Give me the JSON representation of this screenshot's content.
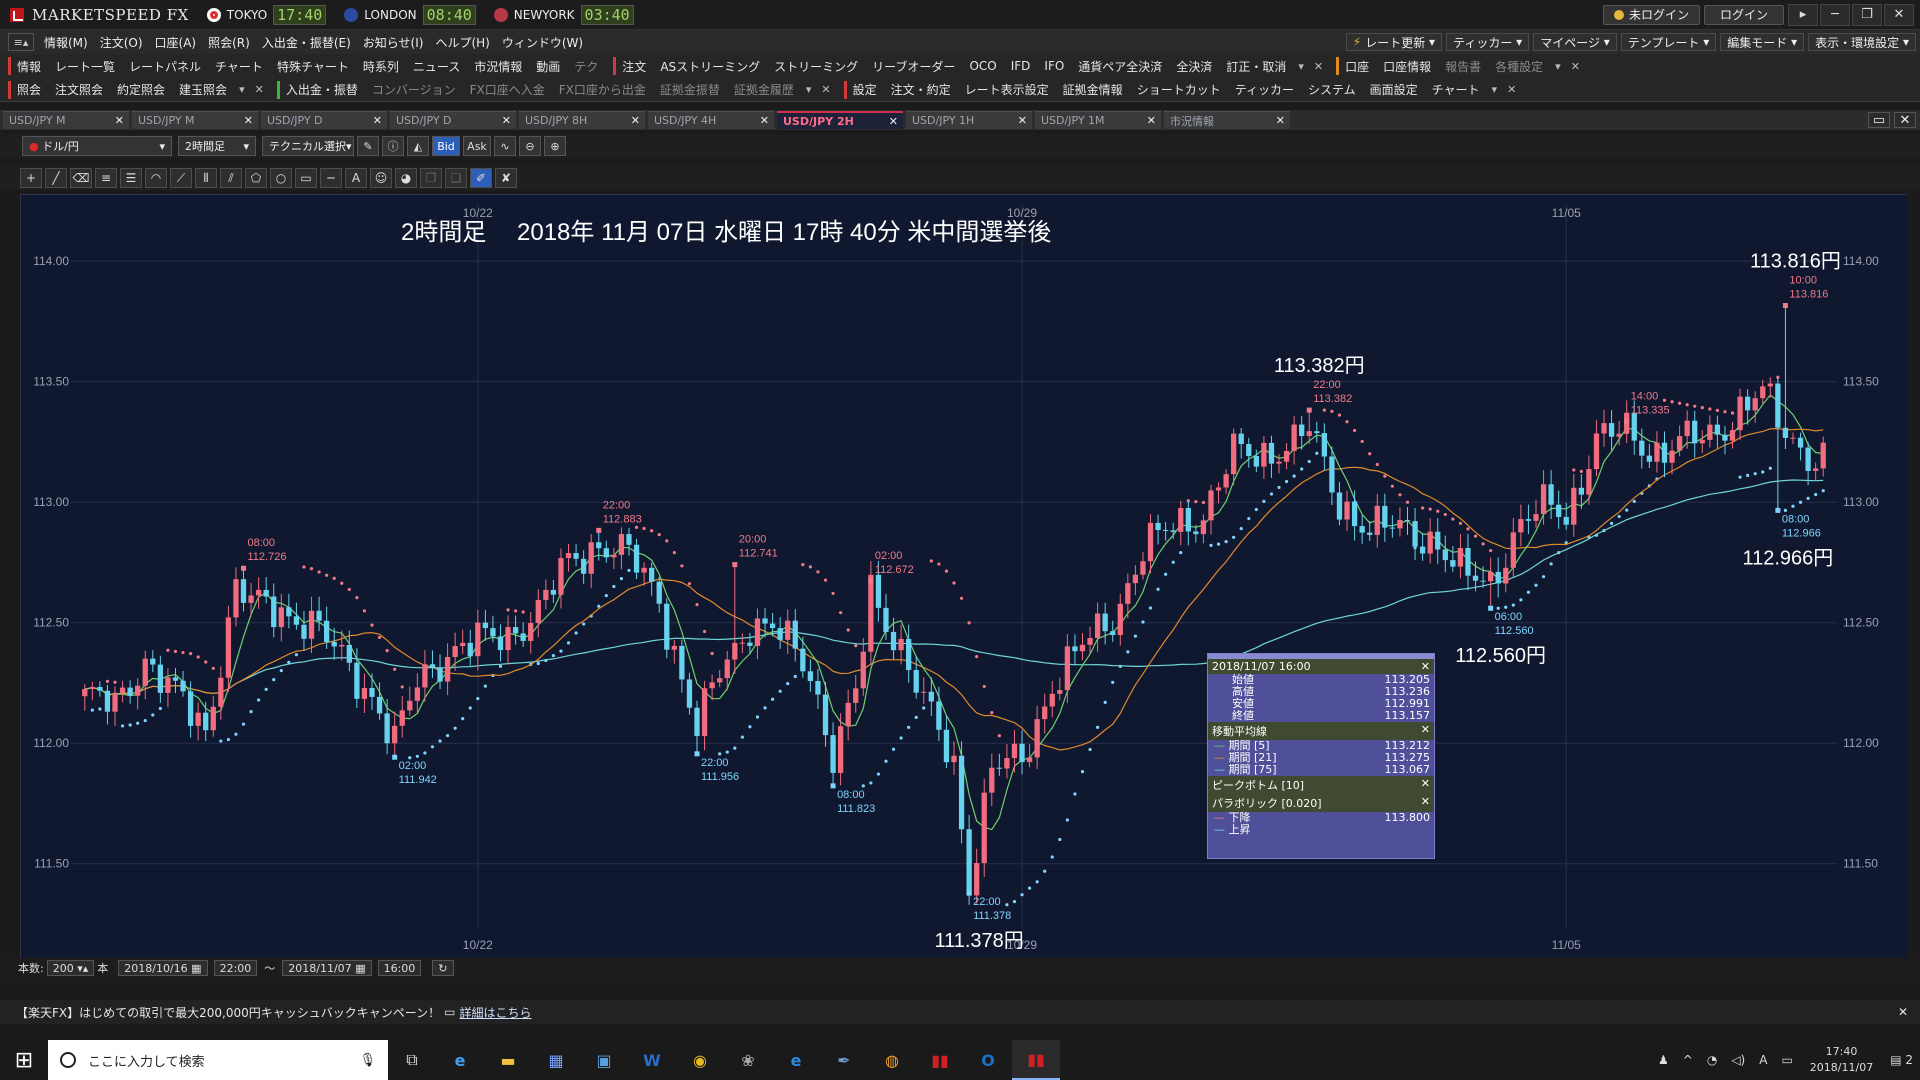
{
  "titlebar": {
    "app_name": "MARKETSPEED FX",
    "clocks": [
      {
        "city": "TOKYO",
        "time": "17:40",
        "flag_color": "#d92a2a"
      },
      {
        "city": "LONDON",
        "time": "08:40",
        "flag_color": "#2a4aa0"
      },
      {
        "city": "NEWYORK",
        "time": "03:40",
        "flag_color": "#b73a4a"
      }
    ],
    "status": "未ログイン",
    "login": "ログイン"
  },
  "menubar": {
    "items": [
      "情報(M)",
      "注文(O)",
      "口座(A)",
      "照会(R)",
      "入出金・振替(E)",
      "お知らせ(I)",
      "ヘルプ(H)",
      "ウィンドウ(W)"
    ],
    "right": [
      "レート更新",
      "ティッカー",
      "マイページ",
      "テンプレート",
      "編集モード",
      "表示・環境設定"
    ]
  },
  "toolbar1": {
    "info_head": "情報",
    "info_items": [
      "レート一覧",
      "レートパネル",
      "チャート",
      "特殊チャート",
      "時系列",
      "ニュース",
      "市況情報",
      "動画",
      "テク"
    ],
    "order_head": "注文",
    "order_items": [
      "ASストリーミング",
      "ストリーミング",
      "リーブオーダー",
      "OCO",
      "IFD",
      "IFO",
      "通貨ペア全決済",
      "全決済",
      "訂正・取消"
    ],
    "account_head": "口座",
    "account_items": [
      "口座情報"
    ],
    "account_dim": [
      "報告書",
      "各種設定"
    ]
  },
  "toolbar2": {
    "inquiry_head": "照会",
    "inquiry_items": [
      "注文照会",
      "約定照会",
      "建玉照会"
    ],
    "transfer_head": "入出金・振替",
    "transfer_dim": [
      "コンバージョン",
      "FX口座へ入金",
      "FX口座から出金",
      "証拠金振替",
      "証拠金履歴"
    ],
    "settings_head": "設定",
    "settings_items": [
      "注文・約定",
      "レート表示設定",
      "証拠金情報",
      "ショートカット",
      "ティッカー",
      "システム",
      "画面設定",
      "チャート"
    ]
  },
  "tabs": [
    {
      "label": "USD/JPY M",
      "active": false
    },
    {
      "label": "USD/JPY M",
      "active": false
    },
    {
      "label": "USD/JPY D",
      "active": false
    },
    {
      "label": "USD/JPY D",
      "active": false
    },
    {
      "label": "USD/JPY 8H",
      "active": false
    },
    {
      "label": "USD/JPY 4H",
      "active": false
    },
    {
      "label": "USD/JPY 2H",
      "active": true
    },
    {
      "label": "USD/JPY 1H",
      "active": false
    },
    {
      "label": "USD/JPY 1M",
      "active": false
    },
    {
      "label": "市況情報",
      "active": false
    }
  ],
  "controls": {
    "pair": "ドル/円",
    "timeframe": "2時間足",
    "technical": "テクニカル選択",
    "bid": "Bid",
    "ask": "Ask"
  },
  "bottom": {
    "count_label": "本数:",
    "count_value": "200",
    "count_unit": "本",
    "from_date": "2018/10/16",
    "from_time": "22:00",
    "tilde": "〜",
    "to_date": "2018/11/07",
    "to_time": "16:00"
  },
  "ad": {
    "text": "【楽天FX】はじめての取引で最大200,000円キャッシュバックキャンペーン！",
    "link": "詳細はこちら"
  },
  "taskbar": {
    "search_placeholder": "ここに入力して検索",
    "time": "17:40",
    "date": "2018/11/07",
    "notif": "2",
    "ime": "A"
  },
  "chart_data": {
    "type": "candlestick",
    "title": "2時間足　 2018年 11月 07日 水曜日 17時 40分 米中間選挙後",
    "y_range": [
      111.25,
      114.15
    ],
    "y_ticks": [
      {
        "v": 114.0,
        "label": "114.00"
      },
      {
        "v": 113.5,
        "label": "113.50"
      },
      {
        "v": 113.0,
        "label": "113.00"
      },
      {
        "v": 112.5,
        "label": "112.50"
      },
      {
        "v": 112.0,
        "label": "112.00"
      },
      {
        "v": 111.5,
        "label": "111.50"
      }
    ],
    "x_ticks": [
      {
        "label": "10/22",
        "bar": 52
      },
      {
        "label": "10/29",
        "bar": 124
      },
      {
        "label": "11/05",
        "bar": 196
      }
    ],
    "big_labels": [
      {
        "text": "113.816円",
        "bar": 225,
        "price": 113.816,
        "pos": "above"
      },
      {
        "text": "113.382円",
        "bar": 162,
        "price": 113.382,
        "pos": "above"
      },
      {
        "text": "112.560円",
        "bar": 186,
        "price": 112.56,
        "pos": "below"
      },
      {
        "text": "112.966円",
        "bar": 224,
        "price": 112.966,
        "pos": "below"
      },
      {
        "text": "111.378円",
        "bar": 117,
        "price": 111.378,
        "pos": "below"
      }
    ],
    "peak_bottom": [
      {
        "time": "08:00",
        "value": "112.726",
        "bar": 21,
        "price": 112.726,
        "type": "peak"
      },
      {
        "time": "22:00",
        "value": "112.883",
        "bar": 68,
        "price": 112.883,
        "type": "peak"
      },
      {
        "time": "20:00",
        "value": "112.741",
        "bar": 86,
        "price": 112.741,
        "type": "peak"
      },
      {
        "time": "02:00",
        "value": "112.672",
        "bar": 104,
        "price": 112.672,
        "type": "peak"
      },
      {
        "time": "22:00",
        "value": "113.382",
        "bar": 162,
        "price": 113.382,
        "type": "peak"
      },
      {
        "time": "14:00",
        "value": "113.335",
        "bar": 204,
        "price": 113.335,
        "type": "peak"
      },
      {
        "time": "10:00",
        "value": "113.816",
        "bar": 225,
        "price": 113.816,
        "type": "peak"
      },
      {
        "time": "02:00",
        "value": "111.942",
        "bar": 41,
        "price": 111.942,
        "type": "bottom"
      },
      {
        "time": "22:00",
        "value": "111.956",
        "bar": 81,
        "price": 111.956,
        "type": "bottom"
      },
      {
        "time": "08:00",
        "value": "111.823",
        "bar": 99,
        "price": 111.823,
        "type": "bottom"
      },
      {
        "time": "22:00",
        "value": "111.378",
        "bar": 117,
        "price": 111.378,
        "type": "bottom"
      },
      {
        "time": "06:00",
        "value": "112.560",
        "bar": 186,
        "price": 112.56,
        "type": "bottom"
      },
      {
        "time": "08:00",
        "value": "112.966",
        "bar": 224,
        "price": 112.966,
        "type": "bottom"
      }
    ],
    "anchors": [
      [
        0,
        112.2
      ],
      [
        4,
        112.15
      ],
      [
        8,
        112.35
      ],
      [
        12,
        112.2
      ],
      [
        16,
        112.05
      ],
      [
        20,
        112.65
      ],
      [
        22,
        112.58
      ],
      [
        26,
        112.55
      ],
      [
        30,
        112.5
      ],
      [
        34,
        112.35
      ],
      [
        38,
        112.2
      ],
      [
        41,
        112.0
      ],
      [
        44,
        112.25
      ],
      [
        48,
        112.38
      ],
      [
        52,
        112.42
      ],
      [
        56,
        112.45
      ],
      [
        60,
        112.55
      ],
      [
        64,
        112.75
      ],
      [
        68,
        112.83
      ],
      [
        72,
        112.78
      ],
      [
        76,
        112.6
      ],
      [
        81,
        112.05
      ],
      [
        84,
        112.3
      ],
      [
        88,
        112.5
      ],
      [
        92,
        112.45
      ],
      [
        96,
        112.3
      ],
      [
        99,
        111.95
      ],
      [
        102,
        112.2
      ],
      [
        104,
        112.62
      ],
      [
        108,
        112.4
      ],
      [
        112,
        112.1
      ],
      [
        115,
        111.9
      ],
      [
        117,
        111.42
      ],
      [
        120,
        111.9
      ],
      [
        124,
        111.92
      ],
      [
        128,
        112.25
      ],
      [
        132,
        112.4
      ],
      [
        136,
        112.52
      ],
      [
        140,
        112.8
      ],
      [
        144,
        112.9
      ],
      [
        148,
        112.95
      ],
      [
        152,
        113.2
      ],
      [
        156,
        113.2
      ],
      [
        160,
        113.25
      ],
      [
        162,
        113.3
      ],
      [
        166,
        113.0
      ],
      [
        170,
        112.88
      ],
      [
        174,
        112.9
      ],
      [
        178,
        112.85
      ],
      [
        182,
        112.7
      ],
      [
        186,
        112.68
      ],
      [
        190,
        112.9
      ],
      [
        194,
        113.0
      ],
      [
        196,
        112.95
      ],
      [
        200,
        113.25
      ],
      [
        204,
        113.3
      ],
      [
        208,
        113.2
      ],
      [
        212,
        113.25
      ],
      [
        216,
        113.3
      ],
      [
        220,
        113.4
      ],
      [
        222,
        113.45
      ],
      [
        225,
        113.3
      ],
      [
        228,
        113.2
      ],
      [
        229,
        113.17
      ]
    ]
  },
  "data_window": {
    "datetime": "2018/11/07 16:00",
    "ohlc": [
      {
        "label": "始値",
        "value": "113.205"
      },
      {
        "label": "高値",
        "value": "113.236"
      },
      {
        "label": "安値",
        "value": "112.991"
      },
      {
        "label": "終値",
        "value": "113.157"
      }
    ],
    "ma_head": "移動平均線",
    "ma": [
      {
        "label": "期間 [5]",
        "value": "113.212",
        "color": "#6fcf6f"
      },
      {
        "label": "期間 [21]",
        "value": "113.275",
        "color": "#e08a2a"
      },
      {
        "label": "期間 [75]",
        "value": "113.067",
        "color": "#6fd6d6"
      }
    ],
    "pb_head": "ピークボトム [10]",
    "sar_head": "パラボリック [0.020]",
    "sar": [
      {
        "label": "下降",
        "value": "113.800",
        "color": "#f07a8a"
      },
      {
        "label": "上昇",
        "value": "",
        "color": "#7fd4ff"
      }
    ]
  },
  "colors": {
    "bg": "#101830",
    "up": "#f06c7e",
    "down": "#67d2ee",
    "ma5": "#6fcf6f",
    "ma21": "#e08a2a",
    "ma75": "#6fd6d6",
    "sar_down": "#f07a8a",
    "sar_up": "#7fd4ff",
    "grid": "#26304a"
  }
}
